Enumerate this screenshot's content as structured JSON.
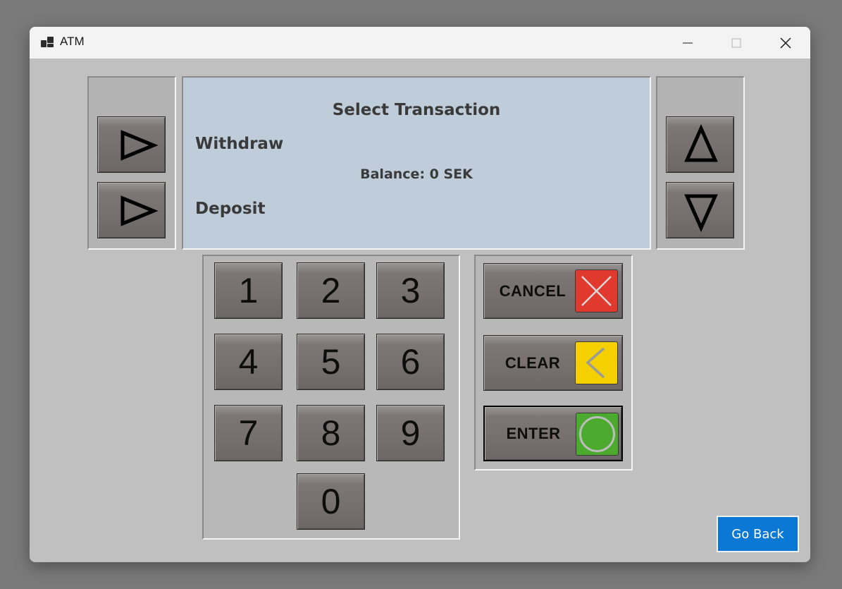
{
  "window": {
    "title": "ATM"
  },
  "screen": {
    "heading": "Select Transaction",
    "option_left_1": "Withdraw",
    "balance": "Balance: 0 SEK",
    "option_left_2": "Deposit"
  },
  "keypad": {
    "keys": [
      "1",
      "2",
      "3",
      "4",
      "5",
      "6",
      "7",
      "8",
      "9",
      "0"
    ]
  },
  "functions": {
    "cancel_label": "CANCEL",
    "clear_label": "CLEAR",
    "enter_label": "ENTER",
    "cancel_color": "#e0392e",
    "clear_color": "#f5d000",
    "enter_color": "#4caa2f"
  },
  "go_back_label": "Go Back",
  "icons": {
    "left_buttons": "triangle-right-icon",
    "scroll_up": "triangle-up-icon",
    "scroll_down": "triangle-down-icon"
  }
}
